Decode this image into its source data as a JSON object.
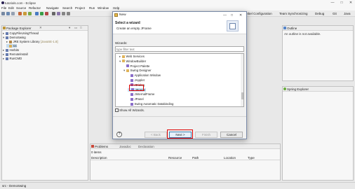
{
  "window": {
    "title": "tutorials.com - Eclipse",
    "minimize": "—",
    "maximize": "□",
    "close": "✕"
  },
  "menubar": [
    "File",
    "Edit",
    "Source",
    "Refactor",
    "Navigate",
    "Search",
    "Project",
    "Run",
    "Window",
    "Help"
  ],
  "toolbar_right": {
    "perspectives": [
      "Rebel Configuration",
      "Team Synchronizing",
      "Debug",
      "Git",
      "Java"
    ]
  },
  "package_explorer": {
    "title": "Package Explorer",
    "items": [
      {
        "label": "CopyFileUsingThread",
        "icon": "project-icon",
        "indent": 0,
        "arrow": "▸"
      },
      {
        "label": "DemoSwing",
        "icon": "project-icon",
        "indent": 0,
        "arrow": "▾"
      },
      {
        "label": "JRE System Library",
        "suffix": "[JavaSE-1.8]",
        "icon": "library-icon",
        "indent": 1,
        "arrow": "▸"
      },
      {
        "label": "src",
        "icon": "package-folder-icon",
        "indent": 1,
        "arrow": "",
        "selected": true
      },
      {
        "label": "Herbits",
        "icon": "project-icon",
        "indent": 0,
        "arrow": "▸"
      },
      {
        "label": "Remotelnstall",
        "icon": "project-icon",
        "indent": 0,
        "arrow": "▸"
      },
      {
        "label": "RunCMD",
        "icon": "project-icon",
        "indent": 0,
        "arrow": "▸"
      }
    ]
  },
  "outline": {
    "title": "Outline",
    "message": "An outline is not available."
  },
  "spring_explorer": {
    "title": "Spring Explorer"
  },
  "problems": {
    "tabs": [
      "Problems",
      "Javadoc",
      "Declaration"
    ],
    "summary": "0 items",
    "columns": [
      "Description",
      "Resource",
      "Path",
      "Location",
      "Type"
    ]
  },
  "status": {
    "text": "src - DemoSwing"
  },
  "dialog": {
    "title": "New",
    "heading": "Select a wizard",
    "subheading": "Create an empty JFrame",
    "wizards_label": "Wizards:",
    "filter_placeholder": "type filter text",
    "tree": [
      {
        "label": "Web Services",
        "indent": 0,
        "arrow": "▸",
        "icon": "folder-icon"
      },
      {
        "label": "WindowBuilder",
        "indent": 0,
        "arrow": "▾",
        "icon": "folder-icon"
      },
      {
        "label": "Project Palette",
        "indent": 1,
        "arrow": "",
        "icon": "swing-icon"
      },
      {
        "label": "Swing Designer",
        "indent": 1,
        "arrow": "▾",
        "icon": "folder-icon"
      },
      {
        "label": "Application Window",
        "indent": 2,
        "arrow": "",
        "icon": "swing-icon"
      },
      {
        "label": "JApplet",
        "indent": 2,
        "arrow": "",
        "icon": "swing-icon"
      },
      {
        "label": "JDialog",
        "indent": 2,
        "arrow": "",
        "icon": "swing-icon"
      },
      {
        "label": "JFrame",
        "indent": 2,
        "arrow": "",
        "icon": "swing-icon",
        "selected": true
      },
      {
        "label": "JInternalFrame",
        "indent": 2,
        "arrow": "",
        "icon": "swing-icon"
      },
      {
        "label": "JPanel",
        "indent": 2,
        "arrow": "",
        "icon": "swing-icon"
      },
      {
        "label": "Swing Automatic Databinding",
        "indent": 2,
        "arrow": "",
        "icon": "swing-icon"
      }
    ],
    "show_all_label": "Show All Wizards.",
    "help": "?",
    "buttons": {
      "back": "< Back",
      "next": "Next >",
      "finish": "Finish",
      "cancel": "Cancel"
    }
  },
  "colors": {
    "highlight": "#d00000",
    "selection": "#cce4f7"
  }
}
